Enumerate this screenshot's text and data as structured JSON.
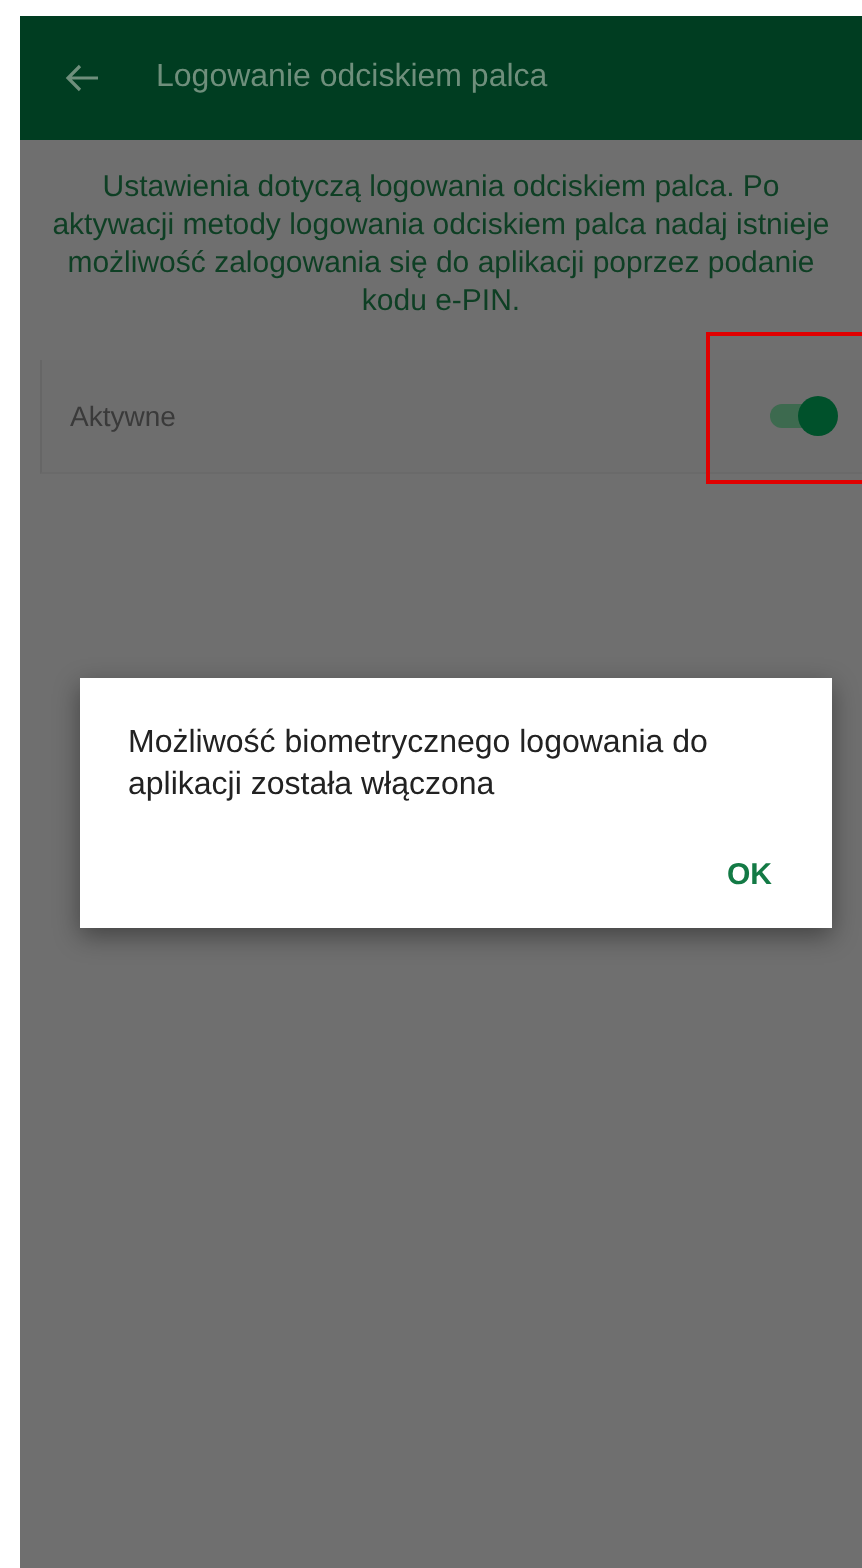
{
  "app_bar": {
    "title": "Logowanie odciskiem palca"
  },
  "description": "Ustawienia dotyczą logowania odciskiem palca. Po aktywacji metody logowania odciskiem palca nadaj istnieje możliwość zalogowania się do aplikacji poprzez podanie kodu e-PIN.",
  "setting": {
    "label": "Aktywne",
    "on": true,
    "highlighted": true
  },
  "dialog": {
    "message": "Możliwość biometrycznego logowania do aplikacji została włączona",
    "button": "OK"
  }
}
